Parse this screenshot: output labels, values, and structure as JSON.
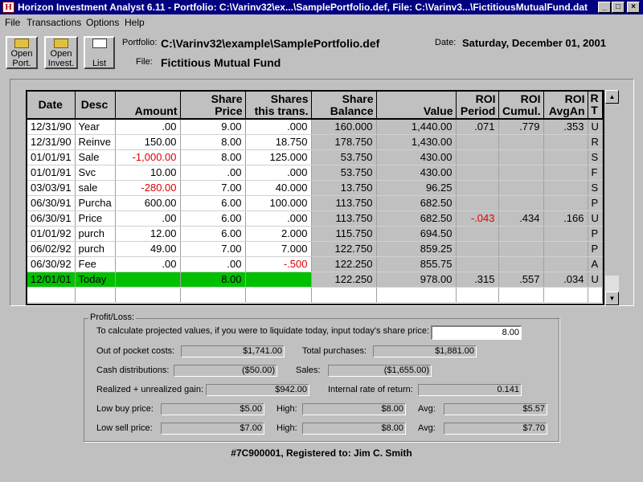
{
  "window": {
    "title": "Horizon Investment Analyst 6.11 - Portfolio: C:\\Varinv32\\ex...\\SamplePortfolio.def, File: C:\\Varinv3...\\FictitiousMutualFund.dat",
    "icon_text": "H",
    "min": "_",
    "max": "□",
    "close": "×"
  },
  "menu": [
    "File",
    "Transactions",
    "Options",
    "Help"
  ],
  "toolbar": {
    "open_port": [
      "Open",
      "Port."
    ],
    "open_invest": [
      "Open",
      "Invest."
    ],
    "list": "List"
  },
  "header": {
    "portfolio_label": "Portfolio:",
    "portfolio_value": "C:\\Varinv32\\example\\SamplePortfolio.def",
    "file_label": "File:",
    "file_value": "Fictitious Mutual Fund",
    "date_label": "Date:",
    "date_value": "Saturday, December 01, 2001"
  },
  "table": {
    "columns": [
      [
        "Date"
      ],
      [
        "Desc"
      ],
      [
        "Amount"
      ],
      [
        "Share",
        "Price"
      ],
      [
        "Shares",
        "this trans."
      ],
      [
        "Share",
        "Balance"
      ],
      [
        "Value"
      ],
      [
        "ROI",
        "Period"
      ],
      [
        "ROI",
        "Cumul."
      ],
      [
        "ROI",
        "AvgAn"
      ],
      [
        "R",
        "T"
      ]
    ],
    "rows": [
      {
        "date": "12/31/90",
        "desc": "Year",
        "amount": ".00",
        "price": "9.00",
        "shares": ".000",
        "balance": "160.000",
        "value": "1,440.00",
        "roi_period": ".071",
        "roi_cumul": ".779",
        "roi_avg": ".353",
        "rt": "U"
      },
      {
        "date": "12/31/90",
        "desc": "Reinve",
        "amount": "150.00",
        "price": "8.00",
        "shares": "18.750",
        "balance": "178.750",
        "value": "1,430.00",
        "roi_period": "",
        "roi_cumul": "",
        "roi_avg": "",
        "rt": "R"
      },
      {
        "date": "01/01/91",
        "desc": "Sale",
        "amount": "-1,000.00",
        "price": "8.00",
        "shares": "125.000",
        "balance": "53.750",
        "value": "430.00",
        "roi_period": "",
        "roi_cumul": "",
        "roi_avg": "",
        "rt": "S"
      },
      {
        "date": "01/01/91",
        "desc": "Svc",
        "amount": "10.00",
        "price": ".00",
        "shares": ".000",
        "balance": "53.750",
        "value": "430.00",
        "roi_period": "",
        "roi_cumul": "",
        "roi_avg": "",
        "rt": "F"
      },
      {
        "date": "03/03/91",
        "desc": "sale",
        "amount": "-280.00",
        "price": "7.00",
        "shares": "40.000",
        "balance": "13.750",
        "value": "96.25",
        "roi_period": "",
        "roi_cumul": "",
        "roi_avg": "",
        "rt": "S"
      },
      {
        "date": "06/30/91",
        "desc": "Purcha",
        "amount": "600.00",
        "price": "6.00",
        "shares": "100.000",
        "balance": "113.750",
        "value": "682.50",
        "roi_period": "",
        "roi_cumul": "",
        "roi_avg": "",
        "rt": "P"
      },
      {
        "date": "06/30/91",
        "desc": "Price",
        "amount": ".00",
        "price": "6.00",
        "shares": ".000",
        "balance": "113.750",
        "value": "682.50",
        "roi_period": "-.043",
        "roi_cumul": ".434",
        "roi_avg": ".166",
        "rt": "U"
      },
      {
        "date": "01/01/92",
        "desc": "purch",
        "amount": "12.00",
        "price": "6.00",
        "shares": "2.000",
        "balance": "115.750",
        "value": "694.50",
        "roi_period": "",
        "roi_cumul": "",
        "roi_avg": "",
        "rt": "P"
      },
      {
        "date": "06/02/92",
        "desc": "purch",
        "amount": "49.00",
        "price": "7.00",
        "shares": "7.000",
        "balance": "122.750",
        "value": "859.25",
        "roi_period": "",
        "roi_cumul": "",
        "roi_avg": "",
        "rt": "P"
      },
      {
        "date": "06/30/92",
        "desc": "Fee",
        "amount": ".00",
        "price": ".00",
        "shares": "-.500",
        "balance": "122.250",
        "value": "855.75",
        "roi_period": "",
        "roi_cumul": "",
        "roi_avg": "",
        "rt": "A"
      },
      {
        "date": "12/01/01",
        "desc": "Today",
        "amount": "",
        "price": "8.00",
        "shares": "",
        "balance": "122.250",
        "value": "978.00",
        "roi_period": ".315",
        "roi_cumul": ".557",
        "roi_avg": ".034",
        "rt": "U"
      }
    ]
  },
  "scrollbar": {
    "up": "▲",
    "down": "▼"
  },
  "profit_loss": {
    "title": "Profit/Loss:",
    "prompt": "To calculate projected values, if you were to liquidate today, input today's share price:",
    "share_price_input": "8.00",
    "out_of_pocket_label": "Out of pocket costs:",
    "out_of_pocket": "$1,741.00",
    "total_purchases_label": "Total purchases:",
    "total_purchases": "$1,881.00",
    "cash_dist_label": "Cash distributions:",
    "cash_dist": "($50.00)",
    "sales_label": "Sales:",
    "sales": "($1,655.00)",
    "gain_label": "Realized + unrealized gain:",
    "gain": "$942.00",
    "irr_label": "Internal rate of return:",
    "irr": "0.141",
    "low_buy_label": "Low buy price:",
    "low_buy": "$5.00",
    "high_label": "High:",
    "buy_high": "$8.00",
    "avg_label": "Avg:",
    "buy_avg": "$5.57",
    "low_sell_label": "Low sell price:",
    "low_sell": "$7.00",
    "sell_high": "$8.00",
    "sell_avg": "$7.70"
  },
  "footer": "#7C900001, Registered to: Jim C. Smith",
  "colors": {
    "titlebar": "#000080",
    "today_row": "#00c000",
    "negative": "#e00000",
    "window": "#c0c0c0"
  }
}
